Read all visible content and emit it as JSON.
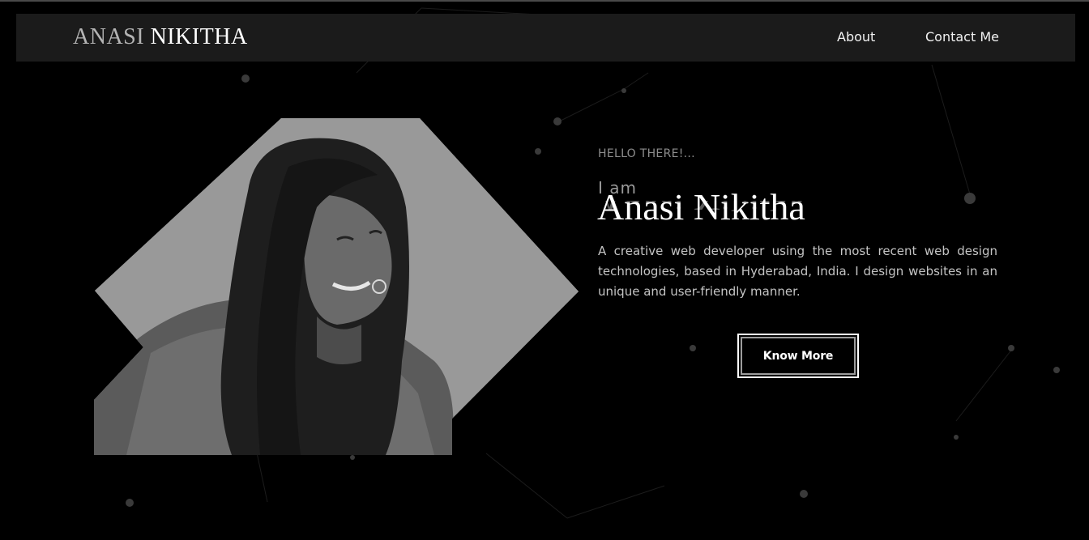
{
  "header": {
    "brand_first": "ANASI",
    "brand_last": "NIKITHA",
    "nav": {
      "about": "About",
      "contact": "Contact Me"
    }
  },
  "hero": {
    "greeting": "HELLO THERE!...",
    "intro": "I am",
    "name": "Anasi Nikitha",
    "description": "A creative web developer using the most recent web design technologies, based in Hyderabad, India. I design websites in an unique and user-friendly manner.",
    "cta_label": "Know More"
  },
  "colors": {
    "background": "#000000",
    "navbar": "#1b1b1b",
    "brand_dim": "#b4b4b4",
    "text_primary": "#ffffff",
    "text_muted": "#8d8d8d",
    "photo_backdrop": "#999999"
  }
}
